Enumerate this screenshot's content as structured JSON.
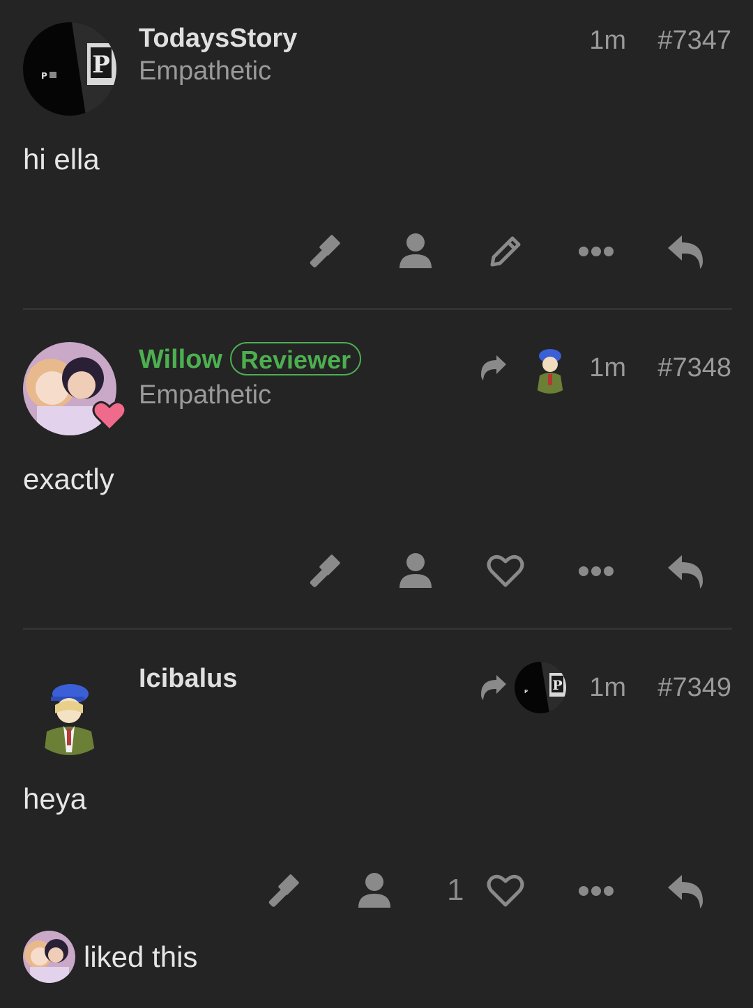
{
  "posts": [
    {
      "username": "TodaysStory",
      "user_title": "Empathetic",
      "time": "1m",
      "post_number": "#7347",
      "body": "hi ella",
      "actions": [
        "flag-icon",
        "user-icon",
        "edit-icon",
        "more-icon",
        "reply-icon"
      ]
    },
    {
      "username": "Willow",
      "badge": "Reviewer",
      "user_title": "Empathetic",
      "time": "1m",
      "post_number": "#7348",
      "body": "exactly",
      "actions": [
        "flag-icon",
        "user-icon",
        "like-icon",
        "more-icon",
        "reply-icon"
      ]
    },
    {
      "username": "Icibalus",
      "time": "1m",
      "post_number": "#7349",
      "body": "heya",
      "like_count": "1",
      "actions": [
        "flag-icon",
        "user-icon",
        "like-icon",
        "more-icon",
        "reply-icon"
      ]
    }
  ],
  "liked_text": "liked this",
  "colors": {
    "background": "#242424",
    "reviewer_green": "#4caf50",
    "muted": "#9a9a9a",
    "icon": "#8a8a8a"
  }
}
